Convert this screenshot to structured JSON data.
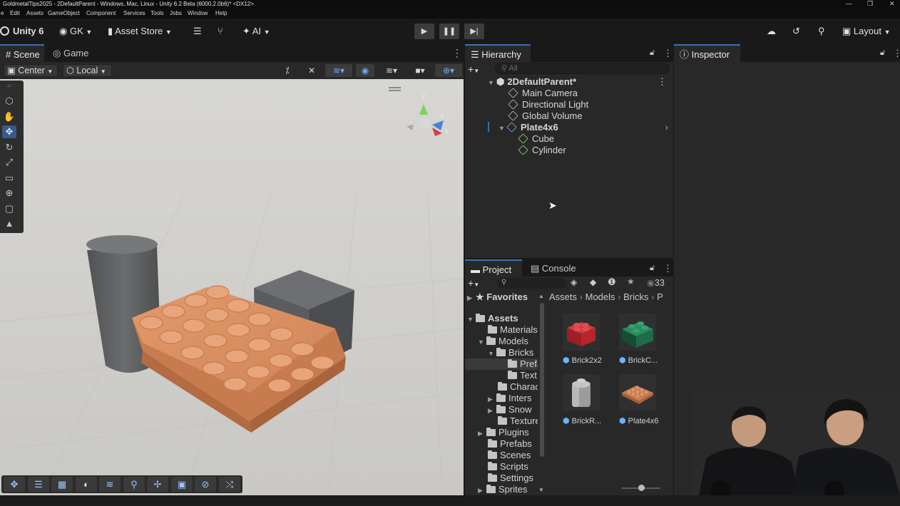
{
  "window": {
    "title": "GoldmetalTips2025 - 2DefaultParent - Windows, Mac, Linux - Unity 6.2 Beta (6000.2.0b6)* <DX12>",
    "controls": [
      "—",
      "❐",
      "✕"
    ]
  },
  "menu": [
    "e",
    "Edit",
    "Assets",
    "GameObject",
    "Component",
    "Services",
    "Tools",
    "Jobs",
    "Window",
    "Help"
  ],
  "toolbar": {
    "unity_label": "Unity 6",
    "account_label": "GK",
    "asset_store_label": "Asset Store",
    "ai_label": "AI",
    "layout_label": "Layout"
  },
  "scene_panel": {
    "tabs": [
      "Scene",
      "Game"
    ],
    "pivot_mode": "Center",
    "pivot_rotation": "Local",
    "gizmo_axes": [
      "y",
      "z",
      "x"
    ]
  },
  "hierarchy": {
    "tab_label": "Hierarchy",
    "search_placeholder": "All",
    "scene_name": "2DefaultParent*",
    "items": [
      "Main Camera",
      "Directional Light",
      "Global Volume"
    ],
    "parent": "Plate4x6",
    "children": [
      "Cube",
      "Cylinder"
    ]
  },
  "inspector": {
    "tab_label": "Inspector"
  },
  "project": {
    "tabs": [
      "Project",
      "Console"
    ],
    "badge_count": "33",
    "favorites_label": "Favorites",
    "breadcrumb": [
      "Assets",
      "Models",
      "Bricks",
      "P"
    ],
    "tree": {
      "assets": "Assets",
      "materials": "Materials",
      "models": "Models",
      "bricks": "Bricks",
      "prefabs": "Prefa",
      "textures": "Text",
      "characters": "Charac",
      "interiors": "Inters",
      "snow": "Snow",
      "textures2": "Texture",
      "plugins": "Plugins",
      "prefabs2": "Prefabs",
      "scenes": "Scenes",
      "scripts": "Scripts",
      "settings": "Settings",
      "sprites": "Sprites"
    },
    "assets": [
      {
        "label": "Brick2x2",
        "color": "#b5262b"
      },
      {
        "label": "BrickC...",
        "color": "#1f6b4a"
      },
      {
        "label": "BrickR...",
        "color": "#a8a8a8"
      },
      {
        "label": "Plate4x6",
        "color": "#b86a43"
      }
    ]
  },
  "colors": {
    "accent": "#3a72b0",
    "plate": "#dc8f62",
    "cylinder": "#5f6163",
    "cube": "#57595c"
  }
}
